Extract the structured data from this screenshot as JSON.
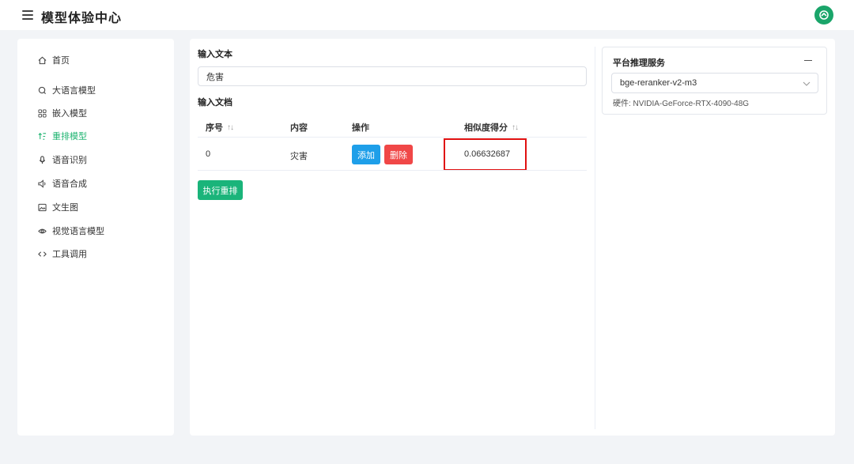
{
  "header": {
    "title": "模型体验中心",
    "menu_icon": "hamburger-icon",
    "avatar_icon": "brand-logo-icon",
    "brand_color": "#1aa56a"
  },
  "sidebar": {
    "accent_color": "#22b573",
    "items": [
      {
        "label": "首页",
        "icon": "home-icon"
      },
      {
        "label": "大语言模型",
        "icon": "chat-icon"
      },
      {
        "label": "嵌入模型",
        "icon": "grid-icon"
      },
      {
        "label": "重排模型",
        "icon": "sort-icon",
        "active": true
      },
      {
        "label": "语音识别",
        "icon": "microphone-icon"
      },
      {
        "label": "语音合成",
        "icon": "speaker-icon"
      },
      {
        "label": "文生图",
        "icon": "image-icon"
      },
      {
        "label": "视觉语言模型",
        "icon": "eye-icon"
      },
      {
        "label": "工具调用",
        "icon": "code-icon"
      }
    ]
  },
  "main": {
    "input_text_label": "输入文本",
    "input_text_value": "危害",
    "docs_label": "输入文档",
    "table": {
      "headers": [
        "序号",
        "内容",
        "操作",
        "相似度得分"
      ],
      "rows": [
        {
          "index": "0",
          "content": "灾害",
          "add": "添加",
          "delete": "删除",
          "score": "0.06632687"
        }
      ]
    },
    "run_button": "执行重排"
  },
  "service": {
    "title": "平台推理服务",
    "selected_model": "bge-reranker-v2-m3",
    "hardware": "硬件: NVIDIA-GeForce-RTX-4090-48G"
  }
}
